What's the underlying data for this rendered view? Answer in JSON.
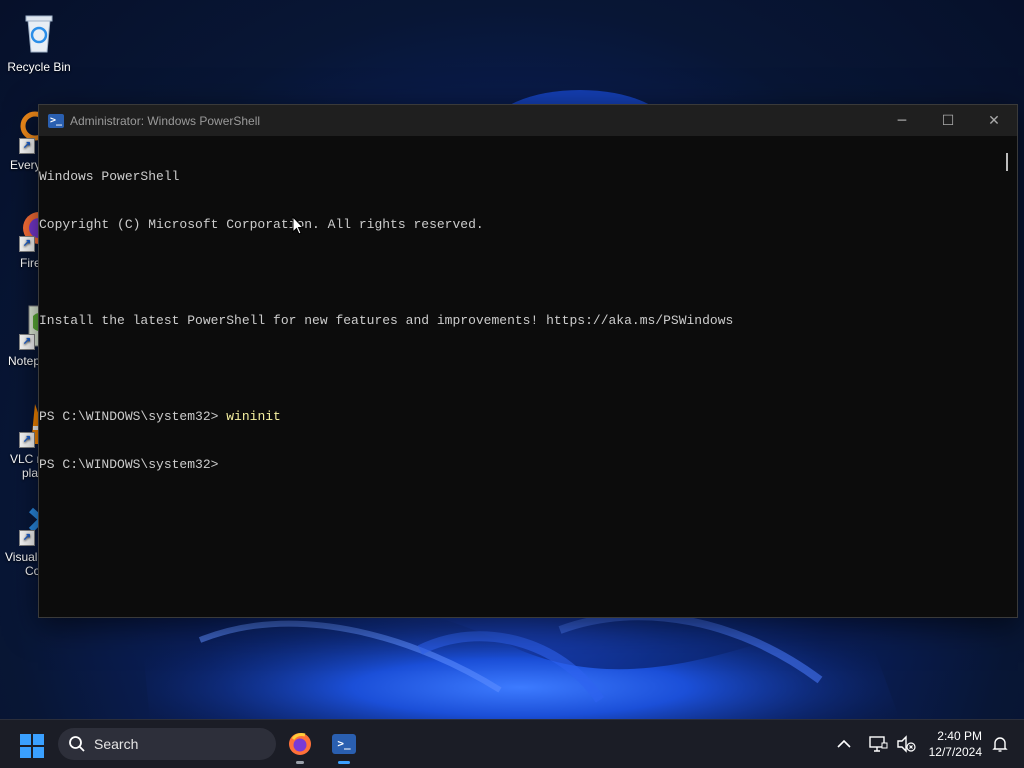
{
  "desktop": {
    "icons": [
      {
        "label": "Recycle Bin",
        "icon": "recycle-bin-icon"
      },
      {
        "label": "Every",
        "icon": "everything-icon"
      },
      {
        "label": "Fire",
        "icon": "firefox-icon"
      },
      {
        "label": "Notep",
        "icon": "notepad-icon"
      },
      {
        "label": "VLC n",
        "label2": "pla",
        "icon": "vlc-icon"
      },
      {
        "label": "Visual",
        "label2": "Co",
        "icon": "vscode-icon"
      }
    ]
  },
  "window": {
    "title": "Administrator: Windows PowerShell",
    "controls": {
      "minimize": "─",
      "maximize": "☐",
      "close": "✕"
    },
    "terminal": {
      "line1": "Windows PowerShell",
      "line2": "Copyright (C) Microsoft Corporation. All rights reserved.",
      "line3": "",
      "line4": "Install the latest PowerShell for new features and improvements! https://aka.ms/PSWindows",
      "line5": "",
      "prompt1": "PS C:\\WINDOWS\\system32> ",
      "command1": "wininit",
      "prompt2": "PS C:\\WINDOWS\\system32> "
    }
  },
  "taskbar": {
    "search_label": "Search",
    "clock_time": "2:40 PM",
    "clock_date": "12/7/2024"
  },
  "colors": {
    "accent": "#3aa0ff",
    "terminal_bg": "#0c0c0c",
    "terminal_text": "#cccccc",
    "command_text": "#f5f0a0"
  }
}
